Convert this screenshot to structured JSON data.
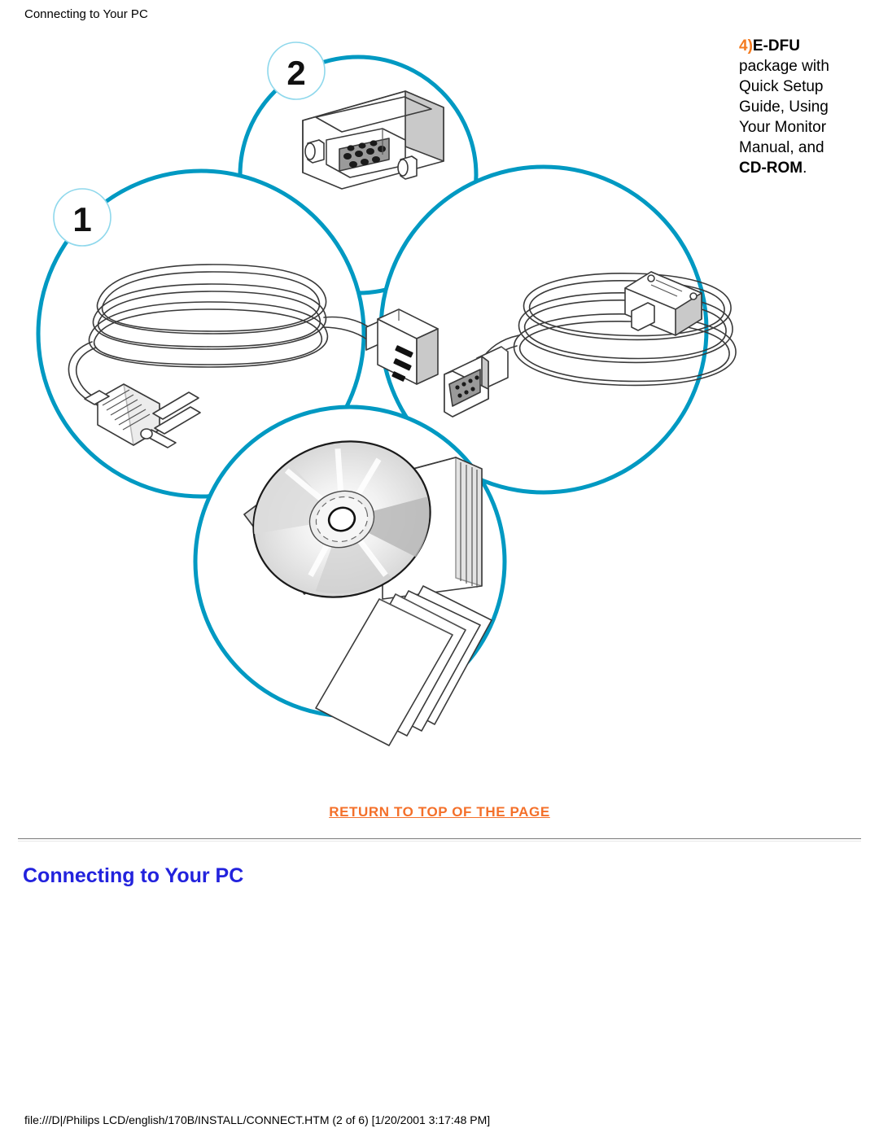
{
  "header": {
    "title": "Connecting to Your PC"
  },
  "figure": {
    "name": "accessories-diagram",
    "circle_color": "#0099C2",
    "badges": [
      {
        "id": "badge-1",
        "label": "1",
        "describes": "power-cable"
      },
      {
        "id": "badge-2",
        "label": "2",
        "describes": "vga-dvi-adapter"
      }
    ],
    "items": [
      {
        "id": "vga-adapter",
        "name": "vga-dvi-adapter-illustration"
      },
      {
        "id": "power-cable",
        "name": "power-cable-illustration"
      },
      {
        "id": "signal-cable",
        "name": "signal-cable-illustration"
      },
      {
        "id": "cd-and-manuals",
        "name": "cd-rom-and-manuals-illustration"
      }
    ]
  },
  "side_note": {
    "marker": "4)",
    "lead": "E-DFU",
    "body": " package with Quick Setup Guide, Using Your Monitor Manual, and ",
    "tail": "CD-ROM",
    "end": ".",
    "full_text": "4) E-DFU package with Quick Setup Guide, Using Your Monitor Manual, and CD-ROM.",
    "marker_color": "#F47B20"
  },
  "return_link": {
    "label": "RETURN TO TOP OF THE PAGE",
    "color": "#F4702A"
  },
  "section": {
    "heading": "Connecting to Your PC",
    "color": "#2222DD"
  },
  "footer": {
    "path": "file:///D|/Philips LCD/english/170B/INSTALL/CONNECT.HTM (2 of 6) [1/20/2001 3:17:48 PM]"
  }
}
